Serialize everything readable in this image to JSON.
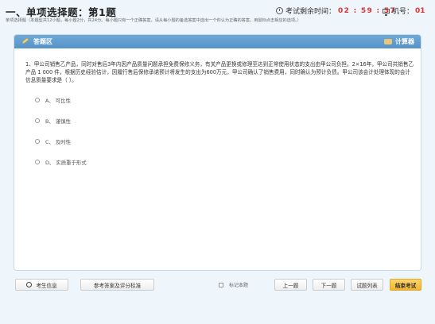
{
  "header": {
    "section_title": "一、单项选择题：第1题",
    "subtitle": "单项选择题（本题型共12小题，每小题2分，共24分。每小题只有一个正确答案，请从每小题的备选答案中选出一个你认为正确的答案，用鼠标点击相应的选项。）",
    "timer_label": "考试剩余时间：",
    "timer_value": "02 : 59 : 57",
    "machine_label": "机号：",
    "machine_value": "01"
  },
  "panel": {
    "title": "答题区",
    "calculator_label": "计算器"
  },
  "question": {
    "text": "1、甲公司销售乙产品，同时对售后3年内因产品质量问题承担免费保修义务，有关产品更换或修理至达到正常使用状态的支出由甲公司负担。2×16年，甲公司共销售乙产品 1 000 件，根据历史经验估计，因履行售后保修承诺预计将发生的支出为600万元，甲公司确认了销售费用，同时确认为预计负债。甲公司该会计处理体现的会计信息质量要求是（   ）。",
    "options": [
      {
        "label": "A、 可比性"
      },
      {
        "label": "B、 谨慎性"
      },
      {
        "label": "C、 及时性"
      },
      {
        "label": "D、 实质重于形式"
      }
    ]
  },
  "footer": {
    "candidate_info": "考生信息",
    "reference": "参考答案及评分标准",
    "mark_label": "标记本题",
    "prev": "上一题",
    "next": "下一题",
    "list": "试题列表",
    "end": "结束考试"
  },
  "colors": {
    "accent": "#5693c8",
    "timer": "#dd3333",
    "end_button": "#f0b52d"
  }
}
